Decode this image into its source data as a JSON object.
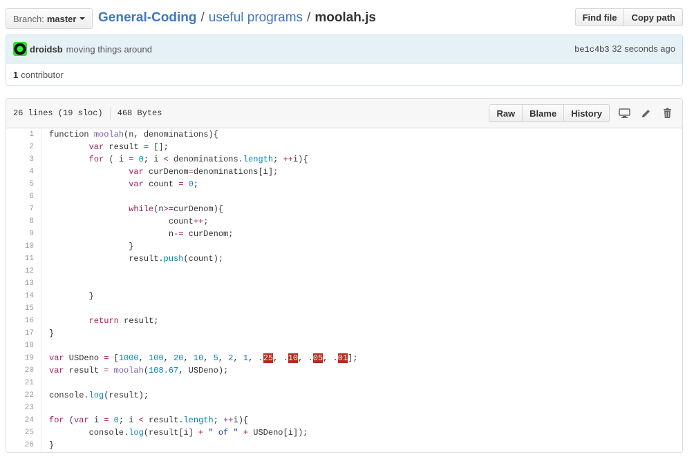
{
  "branch": {
    "prefix": "Branch:",
    "name": "master"
  },
  "breadcrumb": {
    "repo": "General-Coding",
    "folder": "useful programs",
    "file": "moolah.js",
    "sep": "/"
  },
  "top_buttons": {
    "find": "Find file",
    "copy": "Copy path"
  },
  "commit": {
    "author": "droidsb",
    "message": "moving things around",
    "sha": "be1c4b3",
    "time": "32 seconds ago"
  },
  "contributors": {
    "count": "1",
    "label": "contributor"
  },
  "file": {
    "lines": "26 lines (19 sloc)",
    "size": "468 Bytes"
  },
  "file_buttons": {
    "raw": "Raw",
    "blame": "Blame",
    "history": "History"
  },
  "icons": [
    "desktop-icon",
    "pencil-icon",
    "trash-icon"
  ],
  "colors": {
    "link": "#4078c0",
    "keyword": "#a71d5d",
    "function": "#795da3",
    "number": "#0086b3",
    "string": "#183691",
    "error_bg": "#b52a1d"
  },
  "code_lines": [
    [
      [
        "",
        "function "
      ],
      [
        "fn",
        "moolah"
      ],
      [
        "",
        "(n, denominations){"
      ]
    ],
    [
      [
        "",
        "        "
      ],
      [
        "kw",
        "var"
      ],
      [
        "",
        " result "
      ],
      [
        "kw",
        "="
      ],
      [
        "",
        " [];"
      ]
    ],
    [
      [
        "",
        "        "
      ],
      [
        "kw",
        "for"
      ],
      [
        "",
        " ( i "
      ],
      [
        "kw",
        "="
      ],
      [
        "",
        " "
      ],
      [
        "num",
        "0"
      ],
      [
        "",
        "; i "
      ],
      [
        "kw",
        "<"
      ],
      [
        "",
        " denominations."
      ],
      [
        "prop",
        "length"
      ],
      [
        "",
        "; "
      ],
      [
        "kw",
        "++"
      ],
      [
        "",
        "i){"
      ]
    ],
    [
      [
        "",
        "                "
      ],
      [
        "kw",
        "var"
      ],
      [
        "",
        " curDenom"
      ],
      [
        "kw",
        "="
      ],
      [
        "",
        "denominations[i];"
      ]
    ],
    [
      [
        "",
        "                "
      ],
      [
        "kw",
        "var"
      ],
      [
        "",
        " count "
      ],
      [
        "kw",
        "="
      ],
      [
        "",
        " "
      ],
      [
        "num",
        "0"
      ],
      [
        "",
        ";"
      ]
    ],
    [
      [
        "",
        ""
      ]
    ],
    [
      [
        "",
        "                "
      ],
      [
        "kw",
        "while"
      ],
      [
        "",
        "(n"
      ],
      [
        "kw",
        ">="
      ],
      [
        "",
        "curDenom){"
      ]
    ],
    [
      [
        "",
        "                        count"
      ],
      [
        "kw",
        "++"
      ],
      [
        "",
        ";"
      ]
    ],
    [
      [
        "",
        "                        n"
      ],
      [
        "kw",
        "-="
      ],
      [
        "",
        " curDenom;"
      ]
    ],
    [
      [
        "",
        "                }"
      ]
    ],
    [
      [
        "",
        "                result."
      ],
      [
        "prop",
        "push"
      ],
      [
        "",
        "(count);"
      ]
    ],
    [
      [
        "",
        ""
      ]
    ],
    [
      [
        "",
        ""
      ]
    ],
    [
      [
        "",
        "        }"
      ]
    ],
    [
      [
        "",
        ""
      ]
    ],
    [
      [
        "",
        "        "
      ],
      [
        "kw",
        "return"
      ],
      [
        "",
        " result;"
      ]
    ],
    [
      [
        "",
        "}"
      ]
    ],
    [
      [
        "",
        ""
      ]
    ],
    [
      [
        "kw",
        "var"
      ],
      [
        "",
        " USDeno "
      ],
      [
        "kw",
        "="
      ],
      [
        "",
        " ["
      ],
      [
        "num",
        "1000"
      ],
      [
        "",
        ", "
      ],
      [
        "num",
        "100"
      ],
      [
        "",
        ", "
      ],
      [
        "num",
        "20"
      ],
      [
        "",
        ", "
      ],
      [
        "num",
        "10"
      ],
      [
        "",
        ", "
      ],
      [
        "num",
        "5"
      ],
      [
        "",
        ", "
      ],
      [
        "num",
        "2"
      ],
      [
        "",
        ", "
      ],
      [
        "num",
        "1"
      ],
      [
        "",
        ", ."
      ],
      [
        "err",
        "25"
      ],
      [
        "",
        ", ."
      ],
      [
        "err",
        "10"
      ],
      [
        "",
        ", ."
      ],
      [
        "err",
        "05"
      ],
      [
        "",
        ", ."
      ],
      [
        "err",
        "01"
      ],
      [
        "",
        "];"
      ]
    ],
    [
      [
        "kw",
        "var"
      ],
      [
        "",
        " result "
      ],
      [
        "kw",
        "="
      ],
      [
        "",
        " "
      ],
      [
        "fn",
        "moolah"
      ],
      [
        "",
        "("
      ],
      [
        "num",
        "108.67"
      ],
      [
        "",
        ", USDeno);"
      ]
    ],
    [
      [
        "",
        ""
      ]
    ],
    [
      [
        "",
        "console."
      ],
      [
        "prop",
        "log"
      ],
      [
        "",
        "(result);"
      ]
    ],
    [
      [
        "",
        ""
      ]
    ],
    [
      [
        "kw",
        "for"
      ],
      [
        "",
        " ("
      ],
      [
        "kw",
        "var"
      ],
      [
        "",
        " i "
      ],
      [
        "kw",
        "="
      ],
      [
        "",
        " "
      ],
      [
        "num",
        "0"
      ],
      [
        "",
        "; i "
      ],
      [
        "kw",
        "<"
      ],
      [
        "",
        " result."
      ],
      [
        "prop",
        "length"
      ],
      [
        "",
        "; "
      ],
      [
        "kw",
        "++"
      ],
      [
        "",
        "i){"
      ]
    ],
    [
      [
        "",
        "        console."
      ],
      [
        "prop",
        "log"
      ],
      [
        "",
        "(result[i] "
      ],
      [
        "kw",
        "+"
      ],
      [
        "",
        " "
      ],
      [
        "str",
        "\" of \""
      ],
      [
        "",
        " "
      ],
      [
        "kw",
        "+"
      ],
      [
        "",
        " USDeno[i]);"
      ]
    ],
    [
      [
        "",
        "}"
      ]
    ]
  ]
}
